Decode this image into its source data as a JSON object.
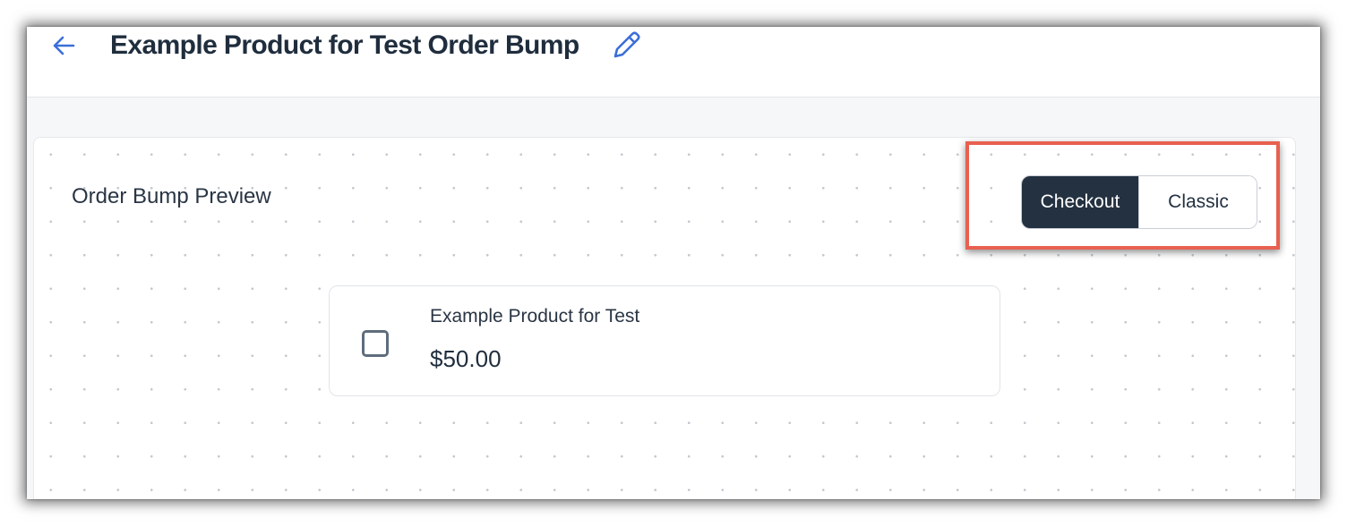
{
  "header": {
    "title": "Example Product for Test Order Bump",
    "back_icon": "arrow-left-icon",
    "edit_icon": "pencil-icon"
  },
  "preview": {
    "title": "Order Bump Preview",
    "view_toggle": {
      "options": [
        "Checkout",
        "Classic"
      ],
      "selected": "Checkout"
    },
    "product": {
      "name": "Example Product for Test",
      "price": "$50.00",
      "checked": false
    }
  },
  "colors": {
    "accent": "#3b6fd8",
    "toggle_active_bg": "#233140",
    "highlight": "#e8604f",
    "title_text": "#1f2d3d"
  }
}
